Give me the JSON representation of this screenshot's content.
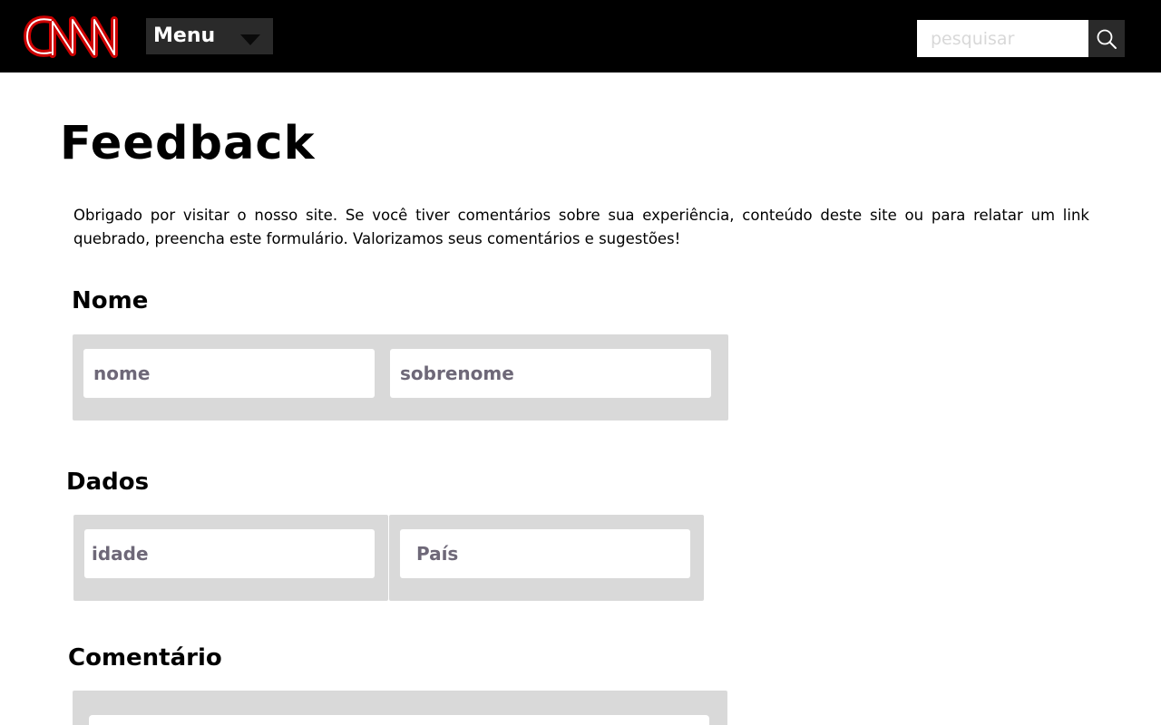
{
  "header": {
    "logo_text": "CNN",
    "menu_label": "Menu",
    "search": {
      "placeholder": "pesquisar",
      "value": ""
    }
  },
  "page": {
    "title": "Feedback",
    "intro": "Obrigado por visitar o nosso site. Se você tiver comentários sobre sua experiência, conteúdo deste site ou para relatar um link quebrado, preencha este formulário. Valorizamos seus comentários e sugestões!"
  },
  "sections": {
    "nome": {
      "title": "Nome",
      "first_name_placeholder": "nome",
      "last_name_placeholder": "sobrenome"
    },
    "dados": {
      "title": "Dados",
      "age_placeholder": "idade",
      "country_placeholder": " País"
    },
    "comentario": {
      "title": "Comentário",
      "comment_placeholder": ""
    }
  },
  "colors": {
    "header_bg": "#000000",
    "logo_red": "#cc0000",
    "panel_bg": "#d9d9d9",
    "placeholder": "#6e6878"
  }
}
